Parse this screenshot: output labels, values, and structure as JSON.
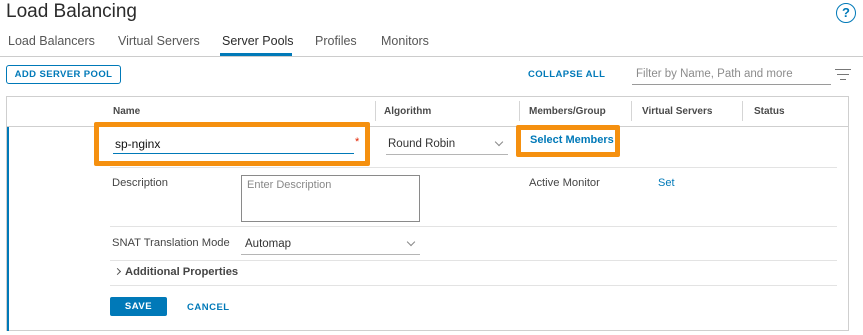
{
  "page": {
    "title": "Load Balancing"
  },
  "tabs": [
    {
      "label": "Load Balancers"
    },
    {
      "label": "Virtual Servers"
    },
    {
      "label": "Server Pools"
    },
    {
      "label": "Profiles"
    },
    {
      "label": "Monitors"
    }
  ],
  "active_tab": "Server Pools",
  "toolbar": {
    "add_label": "ADD SERVER POOL",
    "collapse_label": "COLLAPSE ALL",
    "filter_placeholder": "Filter by Name, Path and more"
  },
  "table": {
    "columns": [
      "Name",
      "Algorithm",
      "Members/Group",
      "Virtual Servers",
      "Status"
    ]
  },
  "form": {
    "name_value": "sp-nginx",
    "required_marker": "*",
    "algorithm_value": "Round Robin",
    "select_members_label": "Select Members",
    "description_label": "Description",
    "description_placeholder": "Enter Description",
    "active_monitor_label": "Active Monitor",
    "set_label": "Set",
    "snat_label": "SNAT Translation Mode",
    "snat_value": "Automap",
    "additional_props_label": "Additional Properties",
    "save_label": "SAVE",
    "cancel_label": "CANCEL"
  },
  "colors": {
    "accent": "#0079b8",
    "highlight": "#f5900f",
    "required": "#e12200"
  },
  "icons": {
    "help": "help-circle-icon",
    "filter": "filter-lines-icon",
    "dropdown": "chevron-down-icon",
    "expand": "chevron-right-icon"
  }
}
